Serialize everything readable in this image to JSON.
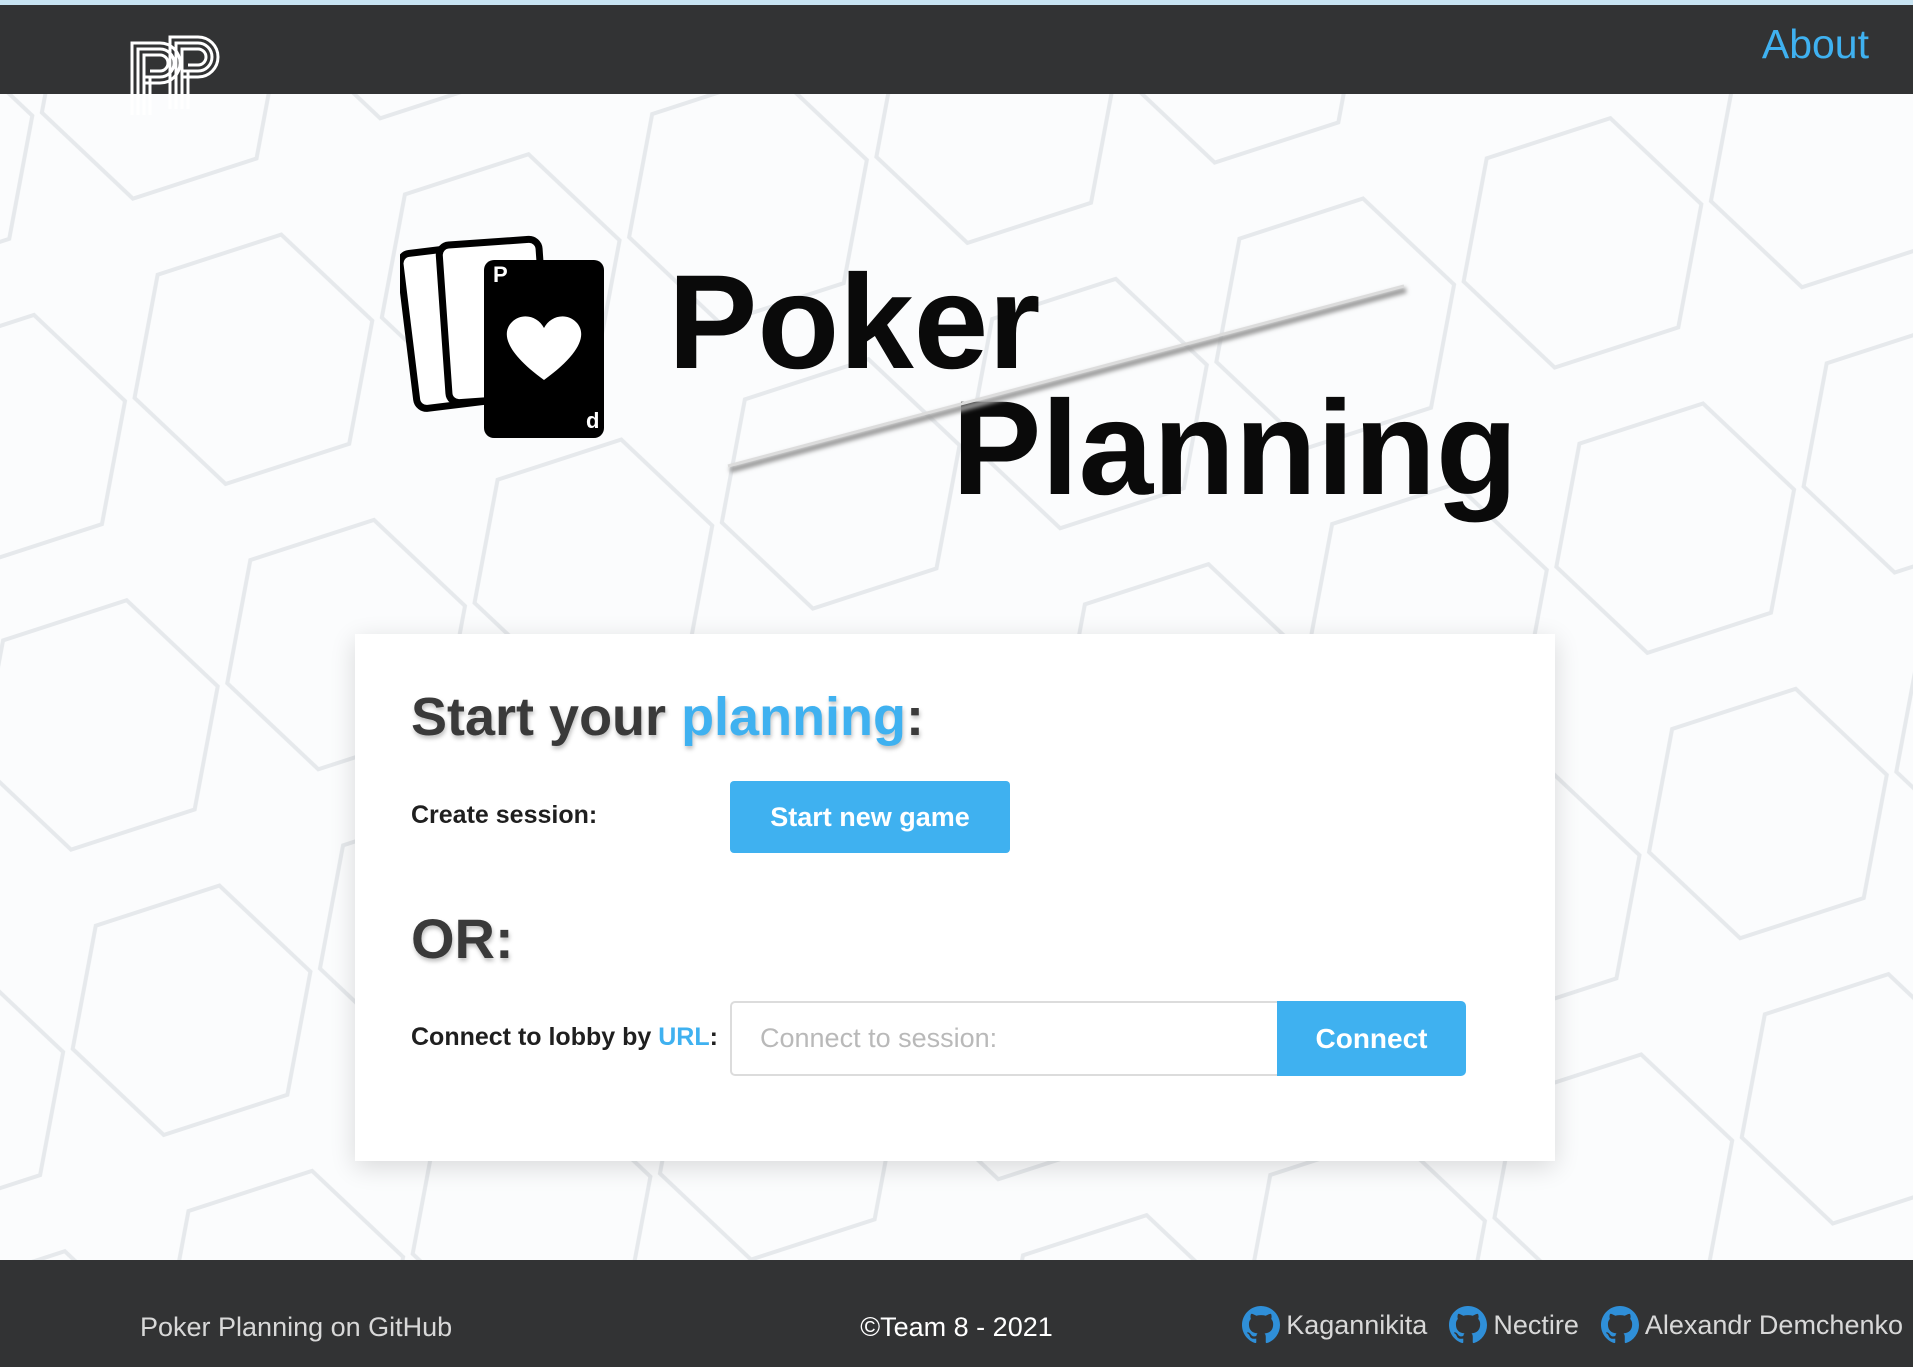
{
  "header": {
    "brand_logo_text": "PP",
    "about_label": "About"
  },
  "hero": {
    "title_line1": "Poker",
    "title_line2": "Planning",
    "card_corner_top": "P",
    "card_corner_bottom": "d"
  },
  "card": {
    "heading_prefix": "Start your ",
    "heading_accent": "planning",
    "heading_suffix": ":",
    "create_label": "Create session:",
    "start_button_label": "Start new game",
    "or_label": "OR:",
    "connect_label_prefix": "Connect to lobby by ",
    "connect_label_accent": "URL",
    "connect_label_suffix": ":",
    "url_placeholder": "Connect to session:",
    "url_value": "",
    "connect_button_label": "Connect"
  },
  "footer": {
    "github_label": "Poker Planning on GitHub",
    "copyright": "©Team 8 - 2021",
    "authors": [
      "Kagannikita",
      "Nectire",
      "Alexandr Demchenko"
    ]
  },
  "colors": {
    "accent": "#3fb1f0",
    "bar_bg": "#323334",
    "page_bg": "#fbfcfd"
  }
}
